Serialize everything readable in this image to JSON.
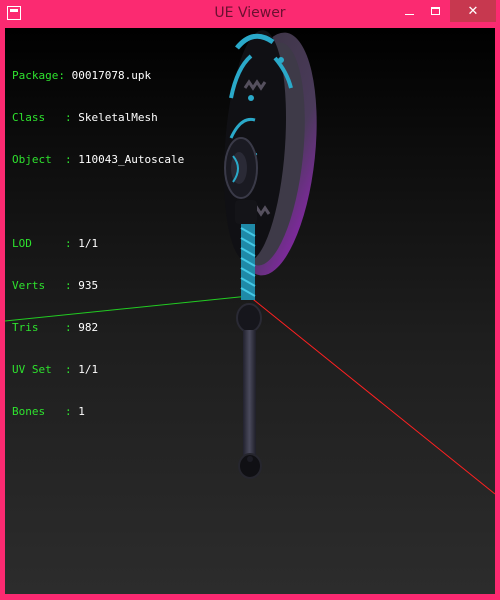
{
  "window": {
    "title": "UE Viewer"
  },
  "info": {
    "package": {
      "key": "Package:",
      "value": "00017078.upk"
    },
    "class": {
      "key": "Class   :",
      "value": "SkeletalMesh"
    },
    "object": {
      "key": "Object  :",
      "value": "110043_Autoscale"
    },
    "lod": {
      "key": "LOD     :",
      "value": "1/1"
    },
    "verts": {
      "key": "Verts   :",
      "value": "935"
    },
    "tris": {
      "key": "Tris    :",
      "value": "982"
    },
    "uvset": {
      "key": "UV Set  :",
      "value": "1/1"
    },
    "bones": {
      "key": "Bones   :",
      "value": "1"
    }
  },
  "colors": {
    "frame": "#fb2a71",
    "info_key": "#2ee22e",
    "axis_x": "#ff2020",
    "axis_y": "#22cc22",
    "weapon_accent": "#2aa9c9",
    "weapon_glow": "#b020c0"
  },
  "icons": {
    "app": "app-window-icon",
    "minimize": "minimize-icon",
    "maximize": "maximize-icon",
    "close": "close-icon"
  }
}
